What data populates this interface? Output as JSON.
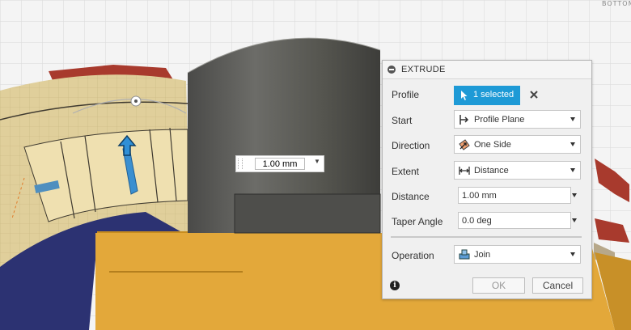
{
  "viewcube": {
    "label": "BOTTOM"
  },
  "canvas_input": {
    "value": "1.00 mm"
  },
  "dialog": {
    "title": "EXTRUDE",
    "rows": {
      "profile": {
        "label": "Profile",
        "selection": "1 selected"
      },
      "start": {
        "label": "Start",
        "value": "Profile Plane"
      },
      "direction": {
        "label": "Direction",
        "value": "One Side"
      },
      "extent": {
        "label": "Extent",
        "value": "Distance"
      },
      "distance": {
        "label": "Distance",
        "value": "1.00 mm"
      },
      "taper": {
        "label": "Taper Angle",
        "value": "0.0 deg"
      },
      "operation": {
        "label": "Operation",
        "value": "Join"
      }
    },
    "buttons": {
      "ok": "OK",
      "cancel": "Cancel"
    }
  },
  "colors": {
    "accent": "#1e9ad6",
    "dialog_bg": "#f0f0f0",
    "sketch_tan": "#e0cf9b",
    "rib_red": "#a83a2d",
    "body_gray": "#5a5a57",
    "block_orange": "#e3a83a",
    "plate_navy": "#2c3272"
  }
}
